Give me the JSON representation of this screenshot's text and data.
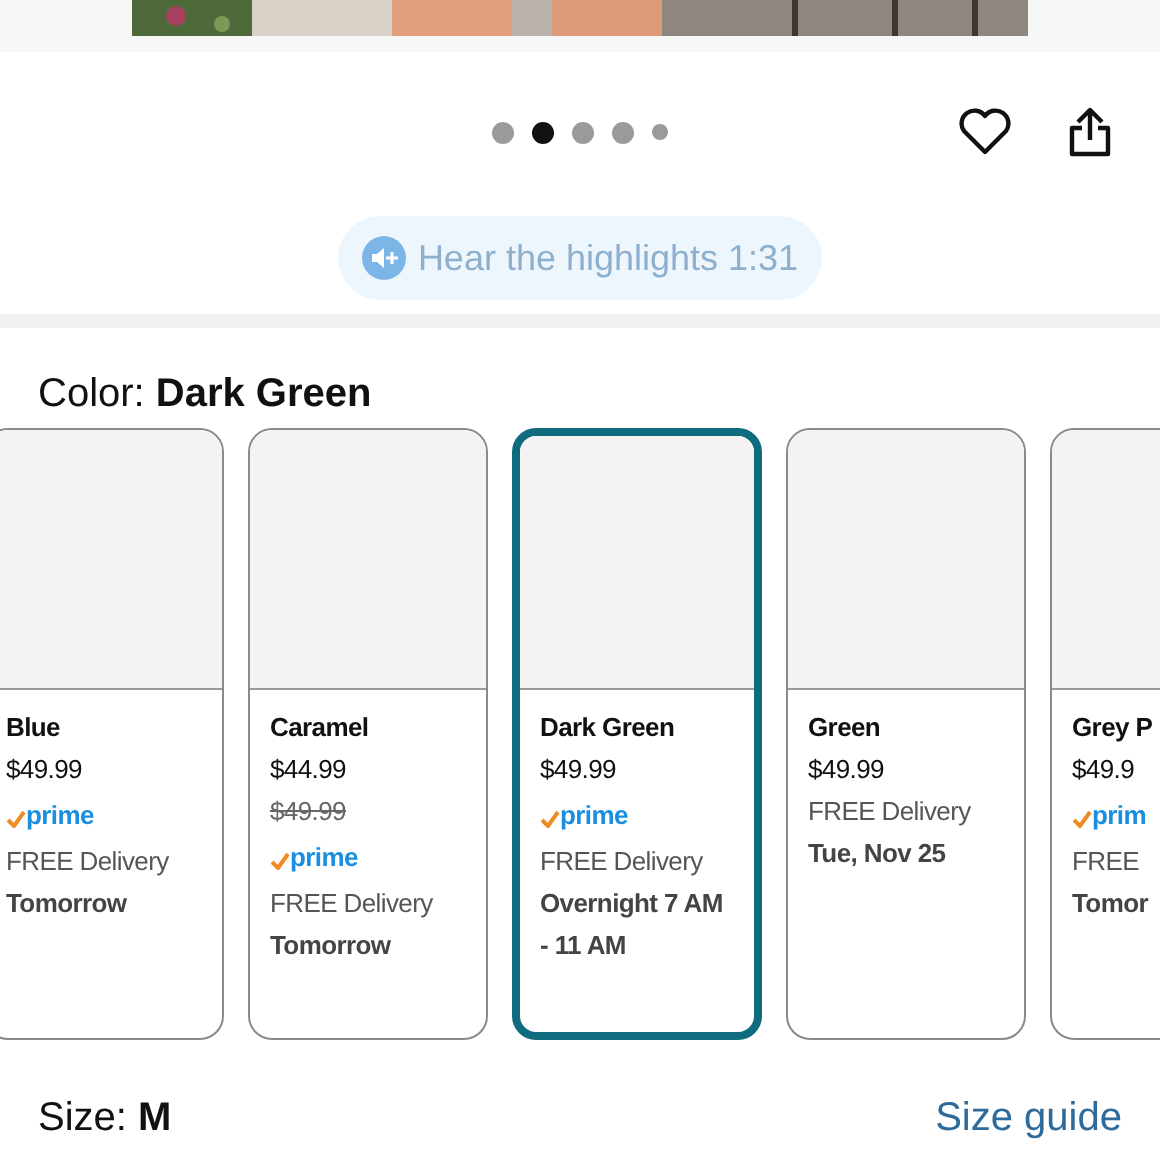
{
  "carousel_dots": [
    {
      "selected": false
    },
    {
      "selected": true
    },
    {
      "selected": false
    },
    {
      "selected": false
    },
    {
      "selected": false
    }
  ],
  "highlights_button": {
    "label": "Hear the highlights 1:31"
  },
  "color_label": "Color: **Dark Green**",
  "swatches": [
    {
      "name": "Blue",
      "price": "$49.99",
      "prime": "prime",
      "delivery": "FREE Delivery",
      "delivery_date": "Tomorrow",
      "selected": false
    },
    {
      "name": "Caramel",
      "price": "$44.99",
      "list_price": "$49.99",
      "prime": "prime",
      "delivery": "FREE Delivery",
      "delivery_date": "Tomorrow",
      "selected": false
    },
    {
      "name": "Dark Green",
      "price": "$49.99",
      "prime": "prime",
      "delivery": "FREE Delivery",
      "delivery_date": "Overnight 7 AM - 11 AM",
      "selected": true
    },
    {
      "name": "Green",
      "price": "$49.99",
      "delivery": "FREE Delivery",
      "delivery_date": "Tue, Nov 25",
      "selected": false
    },
    {
      "name": "Grey P",
      "price": "$49.9",
      "prime": "prim",
      "delivery": "FREE",
      "delivery_date": "Tomor",
      "selected": false
    }
  ],
  "size_label": "Size: **M**",
  "size_guide_link": "Size guide"
}
